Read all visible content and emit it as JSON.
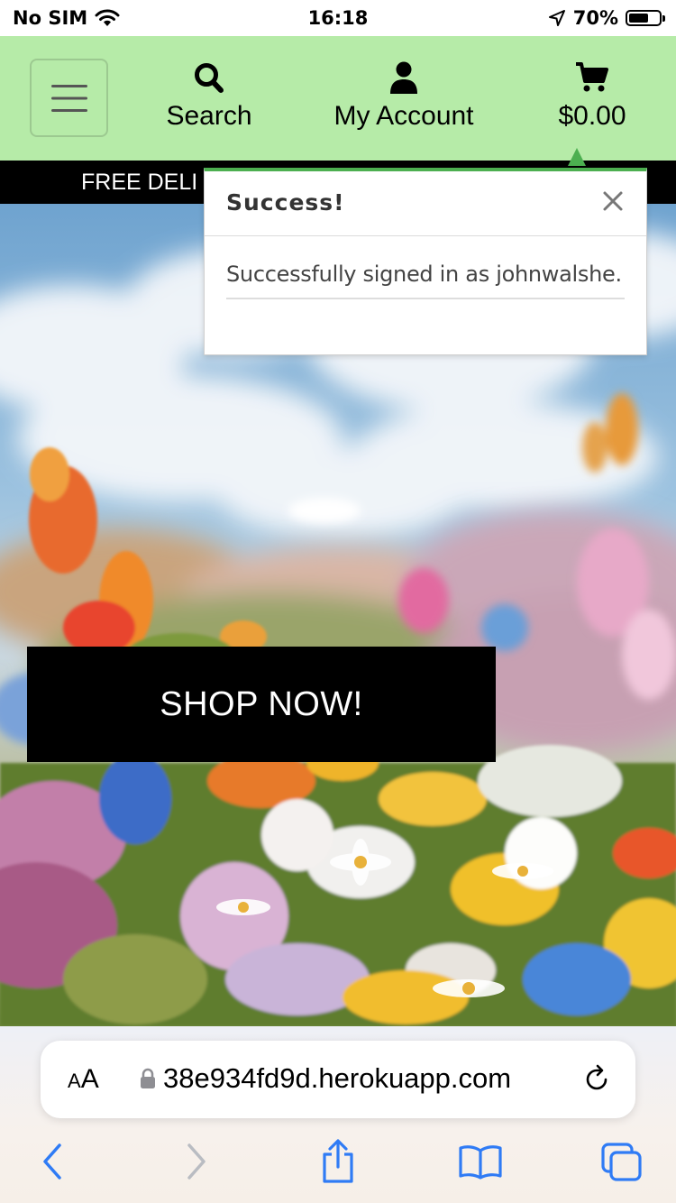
{
  "status_bar": {
    "carrier": "No SIM",
    "time": "16:18",
    "battery_percent": "70%",
    "battery_level": 0.7
  },
  "header": {
    "menu_icon": "hamburger-icon",
    "nav": [
      {
        "label": "Search",
        "icon": "search-icon"
      },
      {
        "label": "My Account",
        "icon": "user-icon"
      },
      {
        "label": "$0.00",
        "icon": "cart-icon"
      }
    ],
    "background": "#b6eba8"
  },
  "promo_banner": {
    "text": "FREE DELI"
  },
  "toast": {
    "title": "Success!",
    "message": "Successfully signed in as johnwalshe.",
    "accent": "#4caf50"
  },
  "hero": {
    "cta_label": "SHOP NOW!"
  },
  "browser": {
    "text_size_label_small": "A",
    "text_size_label_big": "A",
    "url": "38e934fd9d.herokuapp.com",
    "accent": "#2f7bf5"
  }
}
